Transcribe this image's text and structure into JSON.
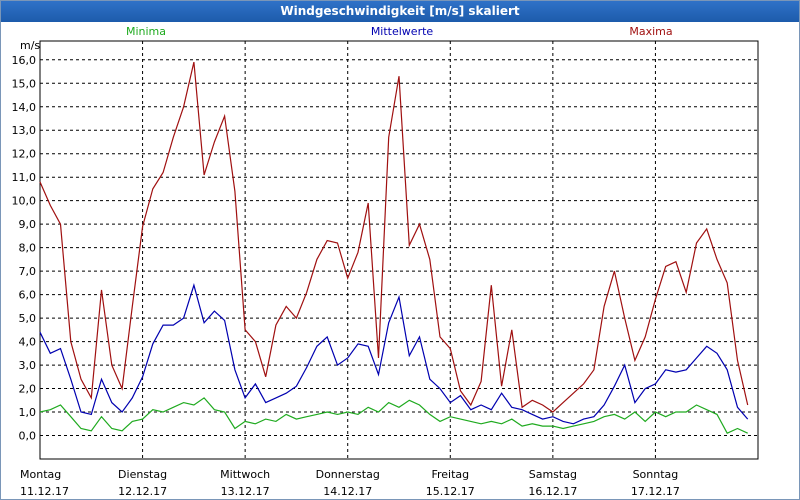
{
  "window": {
    "title": "Windgeschwindigkeit [m/s] skaliert"
  },
  "colors": {
    "minima": "#1faa1f",
    "mittelwerte": "#0000b0",
    "maxima": "#a01010",
    "grid": "#000000"
  },
  "chart_data": {
    "type": "line",
    "title": "Windgeschwindigkeit [m/s] skaliert",
    "ylabel": "m/s",
    "ylim": [
      -1.0,
      16.8
    ],
    "yticks": [
      "0,0",
      "1,0",
      "2,0",
      "3,0",
      "4,0",
      "5,0",
      "6,0",
      "7,0",
      "8,0",
      "9,0",
      "10,0",
      "11,0",
      "12,0",
      "13,0",
      "14,0",
      "15,0",
      "16,0"
    ],
    "days": [
      {
        "name": "Montag",
        "date": "11.12.17"
      },
      {
        "name": "Dienstag",
        "date": "12.12.17"
      },
      {
        "name": "Mittwoch",
        "date": "13.12.17"
      },
      {
        "name": "Donnerstag",
        "date": "14.12.17"
      },
      {
        "name": "Freitag",
        "date": "15.12.17"
      },
      {
        "name": "Samstag",
        "date": "16.12.17"
      },
      {
        "name": "Sonntag",
        "date": "17.12.17"
      }
    ],
    "x_unit": "days since Montag 11.12.17 00:00",
    "legend_position": "top",
    "grid": true,
    "series": [
      {
        "name": "Minima",
        "points": [
          [
            0.0,
            1.0
          ],
          [
            0.1,
            1.1
          ],
          [
            0.2,
            1.3
          ],
          [
            0.3,
            0.8
          ],
          [
            0.4,
            0.3
          ],
          [
            0.5,
            0.2
          ],
          [
            0.6,
            0.8
          ],
          [
            0.7,
            0.3
          ],
          [
            0.8,
            0.2
          ],
          [
            0.9,
            0.6
          ],
          [
            1.0,
            0.7
          ],
          [
            1.1,
            1.1
          ],
          [
            1.2,
            1.0
          ],
          [
            1.3,
            1.2
          ],
          [
            1.4,
            1.4
          ],
          [
            1.5,
            1.3
          ],
          [
            1.6,
            1.6
          ],
          [
            1.7,
            1.1
          ],
          [
            1.8,
            1.0
          ],
          [
            1.9,
            0.3
          ],
          [
            2.0,
            0.6
          ],
          [
            2.1,
            0.5
          ],
          [
            2.2,
            0.7
          ],
          [
            2.3,
            0.6
          ],
          [
            2.4,
            0.9
          ],
          [
            2.5,
            0.7
          ],
          [
            2.6,
            0.8
          ],
          [
            2.7,
            0.9
          ],
          [
            2.8,
            1.0
          ],
          [
            2.9,
            0.9
          ],
          [
            3.0,
            1.0
          ],
          [
            3.1,
            0.9
          ],
          [
            3.2,
            1.2
          ],
          [
            3.3,
            1.0
          ],
          [
            3.4,
            1.4
          ],
          [
            3.5,
            1.2
          ],
          [
            3.6,
            1.5
          ],
          [
            3.7,
            1.3
          ],
          [
            3.8,
            0.9
          ],
          [
            3.9,
            0.6
          ],
          [
            4.0,
            0.8
          ],
          [
            4.1,
            0.7
          ],
          [
            4.2,
            0.6
          ],
          [
            4.3,
            0.5
          ],
          [
            4.4,
            0.6
          ],
          [
            4.5,
            0.5
          ],
          [
            4.6,
            0.7
          ],
          [
            4.7,
            0.4
          ],
          [
            4.8,
            0.5
          ],
          [
            4.9,
            0.4
          ],
          [
            5.0,
            0.4
          ],
          [
            5.1,
            0.3
          ],
          [
            5.2,
            0.4
          ],
          [
            5.3,
            0.5
          ],
          [
            5.4,
            0.6
          ],
          [
            5.5,
            0.8
          ],
          [
            5.6,
            0.9
          ],
          [
            5.7,
            0.7
          ],
          [
            5.8,
            1.0
          ],
          [
            5.9,
            0.6
          ],
          [
            6.0,
            1.0
          ],
          [
            6.1,
            0.8
          ],
          [
            6.2,
            1.0
          ],
          [
            6.3,
            1.0
          ],
          [
            6.4,
            1.3
          ],
          [
            6.5,
            1.1
          ],
          [
            6.6,
            0.9
          ],
          [
            6.7,
            0.1
          ],
          [
            6.8,
            0.3
          ],
          [
            6.9,
            0.1
          ]
        ]
      },
      {
        "name": "Mittelwerte",
        "points": [
          [
            0.0,
            4.4
          ],
          [
            0.1,
            3.5
          ],
          [
            0.2,
            3.7
          ],
          [
            0.3,
            2.4
          ],
          [
            0.4,
            1.0
          ],
          [
            0.5,
            0.9
          ],
          [
            0.6,
            2.4
          ],
          [
            0.7,
            1.4
          ],
          [
            0.8,
            1.0
          ],
          [
            0.9,
            1.6
          ],
          [
            1.0,
            2.5
          ],
          [
            1.1,
            3.9
          ],
          [
            1.2,
            4.7
          ],
          [
            1.3,
            4.7
          ],
          [
            1.4,
            5.0
          ],
          [
            1.5,
            6.4
          ],
          [
            1.6,
            4.8
          ],
          [
            1.7,
            5.3
          ],
          [
            1.8,
            4.9
          ],
          [
            1.9,
            2.8
          ],
          [
            2.0,
            1.6
          ],
          [
            2.1,
            2.2
          ],
          [
            2.2,
            1.4
          ],
          [
            2.3,
            1.6
          ],
          [
            2.4,
            1.8
          ],
          [
            2.5,
            2.1
          ],
          [
            2.6,
            2.9
          ],
          [
            2.7,
            3.8
          ],
          [
            2.8,
            4.2
          ],
          [
            2.9,
            3.0
          ],
          [
            3.0,
            3.3
          ],
          [
            3.1,
            3.9
          ],
          [
            3.2,
            3.8
          ],
          [
            3.3,
            2.6
          ],
          [
            3.4,
            4.8
          ],
          [
            3.5,
            5.9
          ],
          [
            3.6,
            3.4
          ],
          [
            3.7,
            4.2
          ],
          [
            3.8,
            2.4
          ],
          [
            3.9,
            2.0
          ],
          [
            4.0,
            1.4
          ],
          [
            4.1,
            1.7
          ],
          [
            4.2,
            1.1
          ],
          [
            4.3,
            1.3
          ],
          [
            4.4,
            1.1
          ],
          [
            4.5,
            1.8
          ],
          [
            4.6,
            1.2
          ],
          [
            4.7,
            1.1
          ],
          [
            4.8,
            0.9
          ],
          [
            4.9,
            0.7
          ],
          [
            5.0,
            0.8
          ],
          [
            5.1,
            0.6
          ],
          [
            5.2,
            0.5
          ],
          [
            5.3,
            0.7
          ],
          [
            5.4,
            0.8
          ],
          [
            5.5,
            1.3
          ],
          [
            5.6,
            2.1
          ],
          [
            5.7,
            3.0
          ],
          [
            5.8,
            1.4
          ],
          [
            5.9,
            2.0
          ],
          [
            6.0,
            2.2
          ],
          [
            6.1,
            2.8
          ],
          [
            6.2,
            2.7
          ],
          [
            6.3,
            2.8
          ],
          [
            6.4,
            3.3
          ],
          [
            6.5,
            3.8
          ],
          [
            6.6,
            3.5
          ],
          [
            6.7,
            2.8
          ],
          [
            6.8,
            1.2
          ],
          [
            6.9,
            0.7
          ]
        ]
      },
      {
        "name": "Maxima",
        "points": [
          [
            0.0,
            10.8
          ],
          [
            0.1,
            9.8
          ],
          [
            0.2,
            9.0
          ],
          [
            0.3,
            4.0
          ],
          [
            0.4,
            2.4
          ],
          [
            0.5,
            1.6
          ],
          [
            0.6,
            6.2
          ],
          [
            0.7,
            3.0
          ],
          [
            0.8,
            2.0
          ],
          [
            0.9,
            5.5
          ],
          [
            1.0,
            8.9
          ],
          [
            1.1,
            10.5
          ],
          [
            1.2,
            11.2
          ],
          [
            1.3,
            12.7
          ],
          [
            1.4,
            14.0
          ],
          [
            1.5,
            15.9
          ],
          [
            1.6,
            11.1
          ],
          [
            1.7,
            12.5
          ],
          [
            1.8,
            13.6
          ],
          [
            1.9,
            10.4
          ],
          [
            2.0,
            4.5
          ],
          [
            2.1,
            4.0
          ],
          [
            2.2,
            2.5
          ],
          [
            2.3,
            4.7
          ],
          [
            2.4,
            5.5
          ],
          [
            2.5,
            5.0
          ],
          [
            2.6,
            6.1
          ],
          [
            2.7,
            7.5
          ],
          [
            2.8,
            8.3
          ],
          [
            2.9,
            8.2
          ],
          [
            3.0,
            6.7
          ],
          [
            3.1,
            7.8
          ],
          [
            3.2,
            9.9
          ],
          [
            3.3,
            3.3
          ],
          [
            3.4,
            12.7
          ],
          [
            3.5,
            15.3
          ],
          [
            3.6,
            8.1
          ],
          [
            3.7,
            9.0
          ],
          [
            3.8,
            7.5
          ],
          [
            3.9,
            4.2
          ],
          [
            4.0,
            3.7
          ],
          [
            4.1,
            1.9
          ],
          [
            4.2,
            1.3
          ],
          [
            4.3,
            2.3
          ],
          [
            4.4,
            6.4
          ],
          [
            4.5,
            2.1
          ],
          [
            4.6,
            4.5
          ],
          [
            4.7,
            1.2
          ],
          [
            4.8,
            1.5
          ],
          [
            4.9,
            1.3
          ],
          [
            5.0,
            1.0
          ],
          [
            5.1,
            1.4
          ],
          [
            5.2,
            1.8
          ],
          [
            5.3,
            2.2
          ],
          [
            5.4,
            2.8
          ],
          [
            5.5,
            5.5
          ],
          [
            5.6,
            7.0
          ],
          [
            5.7,
            5.0
          ],
          [
            5.8,
            3.2
          ],
          [
            5.9,
            4.2
          ],
          [
            6.0,
            5.8
          ],
          [
            6.1,
            7.2
          ],
          [
            6.2,
            7.4
          ],
          [
            6.3,
            6.1
          ],
          [
            6.4,
            8.2
          ],
          [
            6.5,
            8.8
          ],
          [
            6.6,
            7.5
          ],
          [
            6.7,
            6.5
          ],
          [
            6.8,
            3.2
          ],
          [
            6.9,
            1.3
          ]
        ]
      }
    ]
  }
}
